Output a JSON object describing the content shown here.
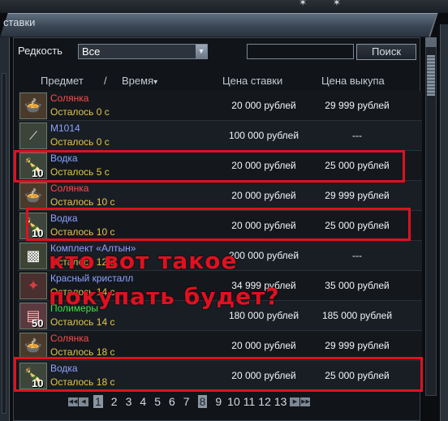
{
  "window": {
    "title": "ставки"
  },
  "filter": {
    "rarity_label": "Редкость",
    "rarity_value": "Все",
    "search_placeholder": "",
    "search_button": "Поиск"
  },
  "headers": {
    "item": "Предмет",
    "separator": "/",
    "time": "Время",
    "sort_arrow": "▾",
    "bid": "Цена ставки",
    "buyout": "Цена выкупа"
  },
  "rows": [
    {
      "name": "Солянка",
      "name_color": "#ff4a4a",
      "time": "Осталось 0 с",
      "bid": "20 000 рублей",
      "buyout": "29 999 рублей",
      "qty": "",
      "icon": "soup-pot-icon"
    },
    {
      "name": "М1014",
      "name_color": "#8da2ff",
      "time": "Осталось 0 с",
      "bid": "100 000 рублей",
      "buyout": "---",
      "qty": "",
      "icon": "shotgun-icon"
    },
    {
      "name": "Водка",
      "name_color": "#8da2ff",
      "time": "Осталось 5 с",
      "bid": "20 000 рублей",
      "buyout": "25 000 рублей",
      "qty": "10",
      "icon": "vodka-bottle-icon"
    },
    {
      "name": "Солянка",
      "name_color": "#ff4a4a",
      "time": "Осталось 10 с",
      "bid": "20 000 рублей",
      "buyout": "29 999 рублей",
      "qty": "",
      "icon": "soup-pot-icon"
    },
    {
      "name": "Водка",
      "name_color": "#8da2ff",
      "time": "Осталось 10 с",
      "bid": "20 000 рублей",
      "buyout": "25 000 рублей",
      "qty": "10",
      "icon": "vodka-bottle-icon"
    },
    {
      "name": "Комплект «Алтын»",
      "name_color": "#8da2ff",
      "time": "Осталось 12 с",
      "bid": "200 000 рублей",
      "buyout": "---",
      "qty": "",
      "icon": "armor-set-icon"
    },
    {
      "name": "Красный кристалл",
      "name_color": "#8da2ff",
      "time": "Осталось 14 с",
      "bid": "34 999 рублей",
      "buyout": "35 000 рублей",
      "qty": "",
      "icon": "red-crystal-icon"
    },
    {
      "name": "Полимеры",
      "name_color": "#3ee23e",
      "time": "Осталось 14 с",
      "bid": "180 000 рублей",
      "buyout": "185 000 рублей",
      "qty": "50",
      "icon": "polymer-pack-icon"
    },
    {
      "name": "Солянка",
      "name_color": "#ff4a4a",
      "time": "Осталось 18 с",
      "bid": "20 000 рублей",
      "buyout": "29 999 рублей",
      "qty": "",
      "icon": "soup-pot-icon"
    },
    {
      "name": "Водка",
      "name_color": "#8da2ff",
      "time": "Осталось 18 с",
      "bid": "20 000 рублей",
      "buyout": "25 000 рублей",
      "qty": "10",
      "icon": "vodka-bottle-icon"
    }
  ],
  "annotation": {
    "line1": "кто вот такое",
    "line2": "покупать будет?",
    "color": "#e01020"
  },
  "pager": {
    "pages": [
      "1",
      "2",
      "3",
      "4",
      "5",
      "6",
      "7",
      "8",
      "9",
      "10",
      "11",
      "12",
      "13"
    ],
    "current": "8"
  }
}
